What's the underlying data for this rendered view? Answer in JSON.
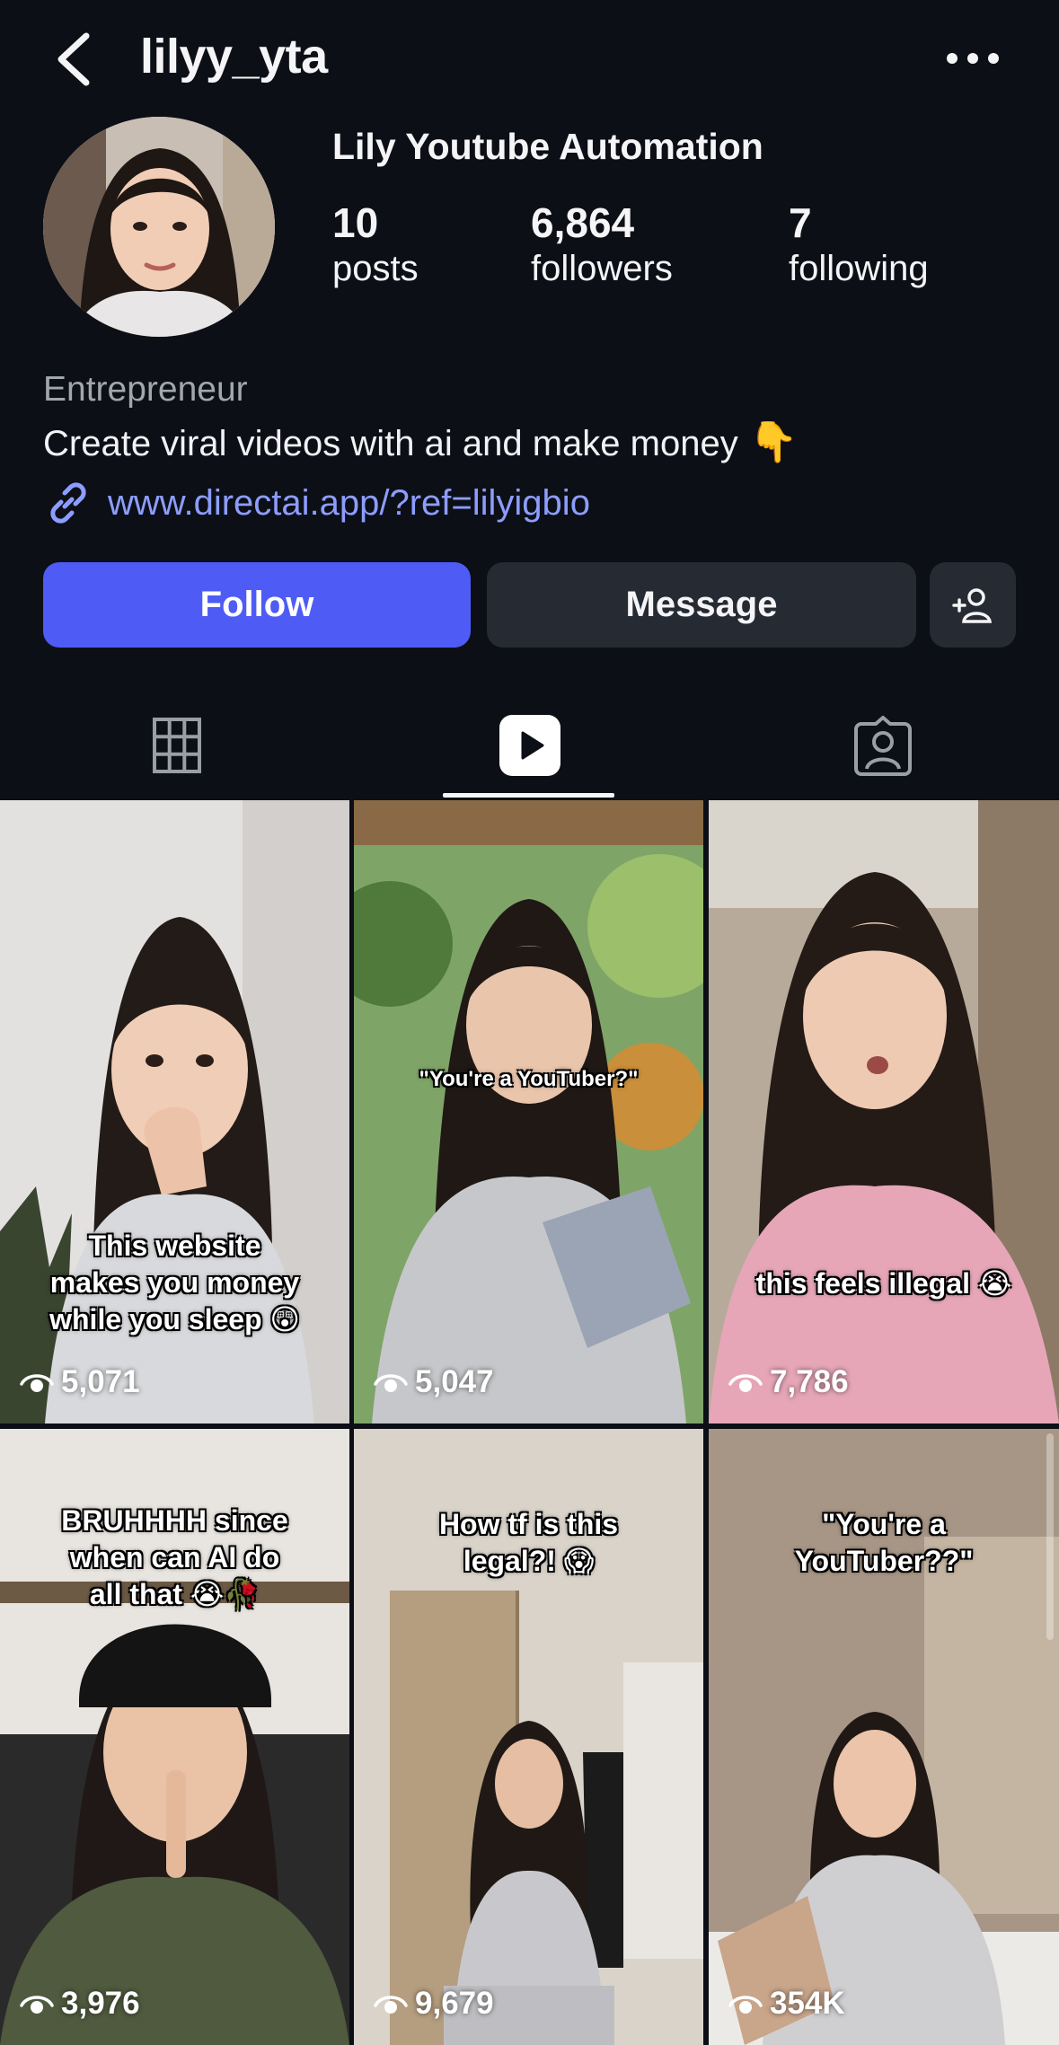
{
  "header": {
    "username": "lilyy_yta"
  },
  "profile": {
    "display_name": "Lily Youtube Automation",
    "stats": [
      {
        "value": "10",
        "label": "posts"
      },
      {
        "value": "6,864",
        "label": "followers"
      },
      {
        "value": "7",
        "label": "following"
      }
    ],
    "category": "Entrepreneur",
    "bio": "Create viral videos with ai and make money",
    "bio_emoji": "👇",
    "link": "www.directai.app/?ref=lilyigbio"
  },
  "actions": {
    "follow_label": "Follow",
    "message_label": "Message"
  },
  "tabs": [
    {
      "icon": "grid-icon",
      "selected": false
    },
    {
      "icon": "reels-icon",
      "selected": true
    },
    {
      "icon": "tagged-icon",
      "selected": false
    }
  ],
  "colors": {
    "background": "#0c0f16",
    "follow_button": "#4e5cf5",
    "secondary_button": "#262a33",
    "link": "#8c9dff"
  },
  "reels": [
    {
      "caption": "This website\nmakes you money\nwhile you sleep 😲",
      "views": "5,071"
    },
    {
      "caption": "\"You're a YouTuber?\"",
      "views": "5,047"
    },
    {
      "caption": "this feels illegal 😭",
      "views": "7,786"
    },
    {
      "caption": "BRUHHHH since\nwhen can AI do\nall that 😭🥀",
      "views": "3,976"
    },
    {
      "caption": "How tf is this\nlegal?! 😱",
      "views": "9,679"
    },
    {
      "caption": "\"You're a\nYouTuber??\"",
      "views": "354K"
    }
  ]
}
